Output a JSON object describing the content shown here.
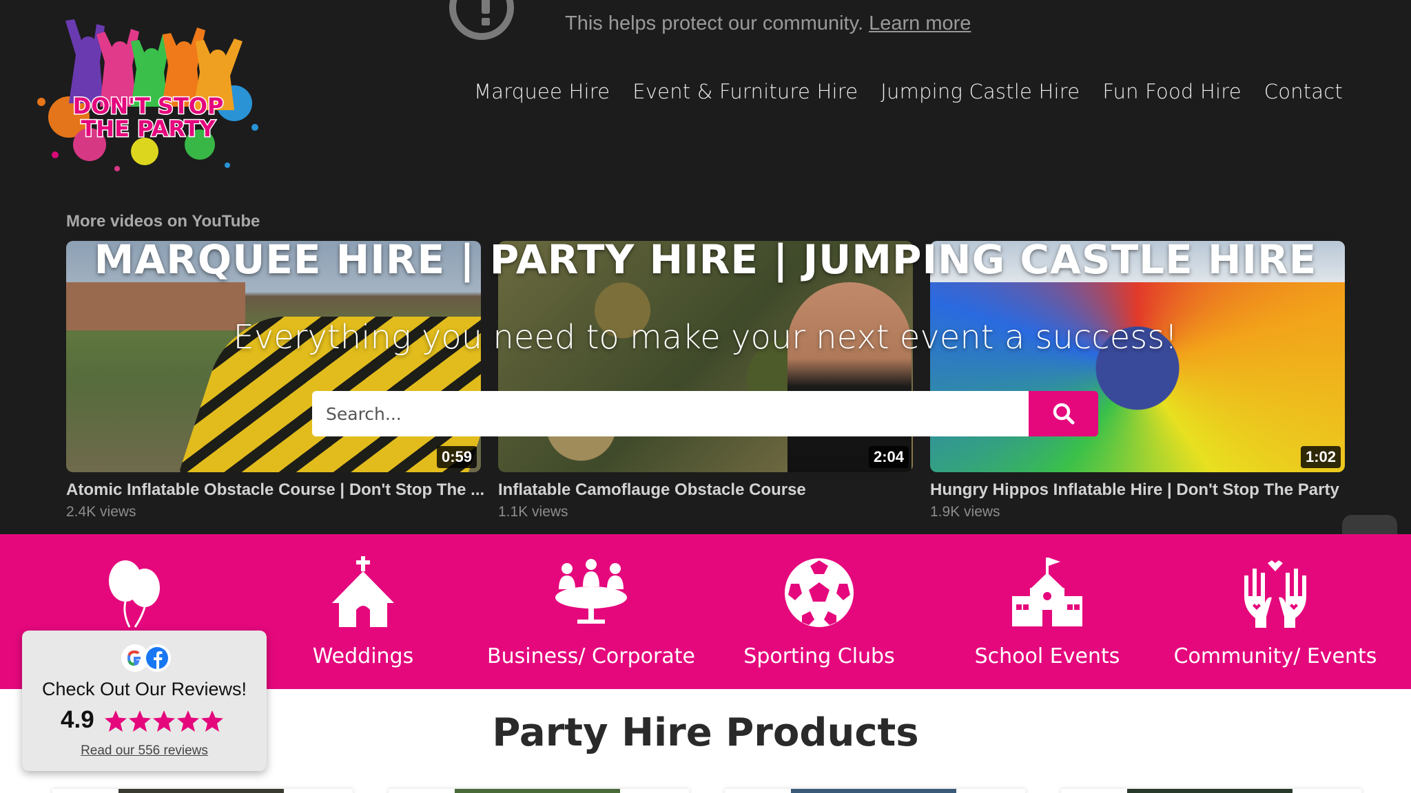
{
  "youtube_notice": {
    "text": "This helps protect our community.",
    "link": "Learn more"
  },
  "logo": {
    "line1": "DON'T STOP",
    "line2": "THE PARTY",
    "alt": "Don't Stop The Party logo"
  },
  "nav": {
    "items": [
      {
        "label": "Marquee Hire"
      },
      {
        "label": "Event & Furniture Hire"
      },
      {
        "label": "Jumping Castle Hire"
      },
      {
        "label": "Fun Food Hire"
      },
      {
        "label": "Contact"
      }
    ]
  },
  "videos": {
    "heading": "More videos on YouTube",
    "items": [
      {
        "title": "Atomic Inflatable Obstacle Course | Don't Stop The ...",
        "views": "2.4K views",
        "duration": "0:59"
      },
      {
        "title": "Inflatable Camoflauge Obstacle Course",
        "views": "1.1K views",
        "duration": "2:04"
      },
      {
        "title": "Hungry Hippos Inflatable Hire | Don't Stop The Party",
        "views": "1.9K views",
        "duration": "1:02"
      }
    ]
  },
  "hero": {
    "title": "MARQUEE HIRE | PARTY HIRE | JUMPING CASTLE HIRE",
    "subtitle": "Everything you need to make your next event a success!"
  },
  "search": {
    "placeholder": "Search..."
  },
  "categories": {
    "items": [
      {
        "label": "",
        "icon": "balloons-icon"
      },
      {
        "label": "Weddings",
        "icon": "church-icon"
      },
      {
        "label": "Business/ Corporate",
        "icon": "meeting-table-icon"
      },
      {
        "label": "Sporting Clubs",
        "icon": "soccer-ball-icon"
      },
      {
        "label": "School Events",
        "icon": "school-icon"
      },
      {
        "label": "Community/ Events",
        "icon": "helping-hands-icon"
      }
    ]
  },
  "products": {
    "heading": "Party Hire Products"
  },
  "reviews": {
    "title": "Check Out Our Reviews!",
    "rating": "4.9",
    "stars": 5,
    "link": "Read our 556 reviews"
  },
  "colors": {
    "brand_pink": "#e5087d",
    "hero_bg": "#1c1c1c"
  }
}
